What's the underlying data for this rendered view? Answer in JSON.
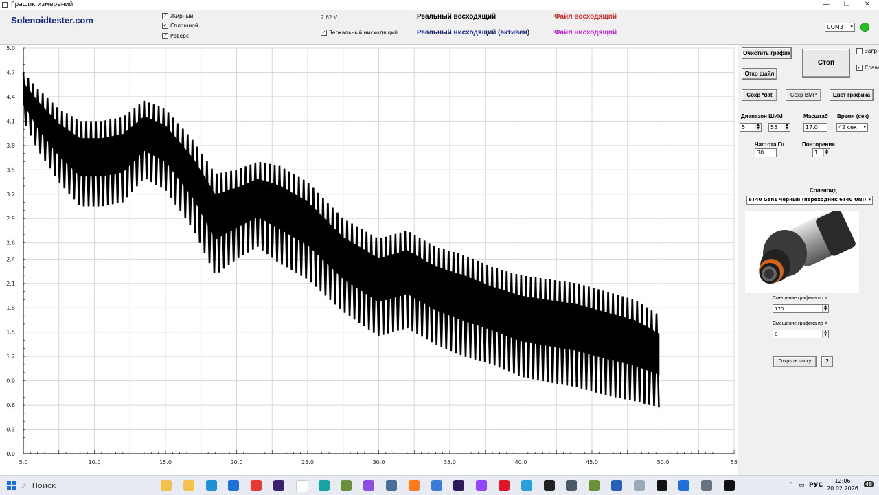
{
  "window": {
    "title": "График измерений",
    "min": "—",
    "max": "❐",
    "close": "✕"
  },
  "header": {
    "brand": "Solenoidtester.com",
    "checkboxes": [
      {
        "label": "Жирный",
        "checked": true
      },
      {
        "label": "Сплошной",
        "checked": true
      },
      {
        "label": "Реверс",
        "checked": true
      }
    ],
    "voltage": "2.62 V",
    "mirror": {
      "label": "Зеркальный нисходящий",
      "checked": true
    },
    "legend": {
      "real_up": "Реальный восходящий",
      "real_down": "Реальный нисходящий (активен)",
      "file_up": "Файл восходящий",
      "file_down": "Файл нисходящий"
    },
    "legend_colors": {
      "real_up": "#000000",
      "real_down": "#1a237e",
      "file_up": "#d32f2f",
      "file_down": "#c026d3"
    },
    "port": "COM3",
    "status_color": "#22c322"
  },
  "panel": {
    "clear_btn": "Очистить график",
    "open_btn": "Откр файл",
    "stop_btn": "Стоп",
    "load_cb": "Загр",
    "compare_cb": "Сравн",
    "save_dat": "Сохр *dat",
    "save_bmp": "Сохр BMP",
    "color_btn": "Цвет графика",
    "pwm_label": "Диапазон ШИМ",
    "pwm_from": "5",
    "pwm_to": "55",
    "scale_label": "Масштаб",
    "scale_value": "17.0",
    "time_label": "Время (сек)",
    "time_value": "42 сек",
    "freq_label": "Частота Гц",
    "freq_value": "30",
    "repeat_label": "Повторения",
    "repeat_value": "1",
    "solenoid_label": "Соленоид",
    "solenoid_value": "6T40 Gen1 черный (переходник 6T40 UNI)",
    "offset_y_label": "Смещение графика по Y",
    "offset_y_value": "170",
    "offset_x_label": "Смещение графика по X",
    "offset_x_value": "0",
    "open_folder": "Открыть папку",
    "help": "?"
  },
  "chart_data": {
    "type": "line",
    "title": "",
    "xlabel": "",
    "ylabel": "",
    "xlim": [
      5.0,
      55
    ],
    "ylim": [
      0.0,
      5.0
    ],
    "xticks": [
      "5.0",
      "10.0",
      "15.0",
      "20.0",
      "25.0",
      "30.0",
      "35.0",
      "40.0",
      "45.0",
      "50.0",
      "55"
    ],
    "yticks": [
      "0.0",
      "0.3",
      "0.6",
      "0.9",
      "1.2",
      "1.5",
      "1.8",
      "2.1",
      "2.4",
      "2.6",
      "2.9",
      "3.2",
      "3.5",
      "3.8",
      "4.1",
      "4.4",
      "4.7",
      "5.0"
    ],
    "grid": true,
    "series": [
      {
        "color": "#000000",
        "x": [
          5.0,
          6.0,
          7.5,
          9.0,
          10.5,
          12.0,
          13.5,
          15.0,
          17.0,
          18.5,
          20.0,
          21.5,
          23.0,
          25.0,
          27.5,
          30.0,
          32.0,
          34.0,
          36.0,
          38.0,
          40.0,
          42.0,
          44.0,
          46.0,
          48.0,
          49.8
        ],
        "upper": [
          4.7,
          4.5,
          4.25,
          4.1,
          4.1,
          4.15,
          4.35,
          4.25,
          3.85,
          3.45,
          3.5,
          3.6,
          3.55,
          3.35,
          2.9,
          2.65,
          2.75,
          2.55,
          2.45,
          2.3,
          2.2,
          2.15,
          2.1,
          2.0,
          1.9,
          1.7
        ],
        "lower": [
          4.1,
          3.75,
          3.35,
          3.05,
          3.05,
          3.1,
          3.4,
          3.25,
          2.75,
          2.2,
          2.4,
          2.55,
          2.35,
          2.15,
          1.75,
          1.45,
          1.55,
          1.35,
          1.2,
          1.1,
          0.95,
          0.88,
          0.82,
          0.72,
          0.65,
          0.57
        ]
      }
    ]
  },
  "taskbar": {
    "search": "Поиск",
    "lang": "РУС",
    "time": "12:06",
    "date": "20.02.2026",
    "badge": "48"
  }
}
